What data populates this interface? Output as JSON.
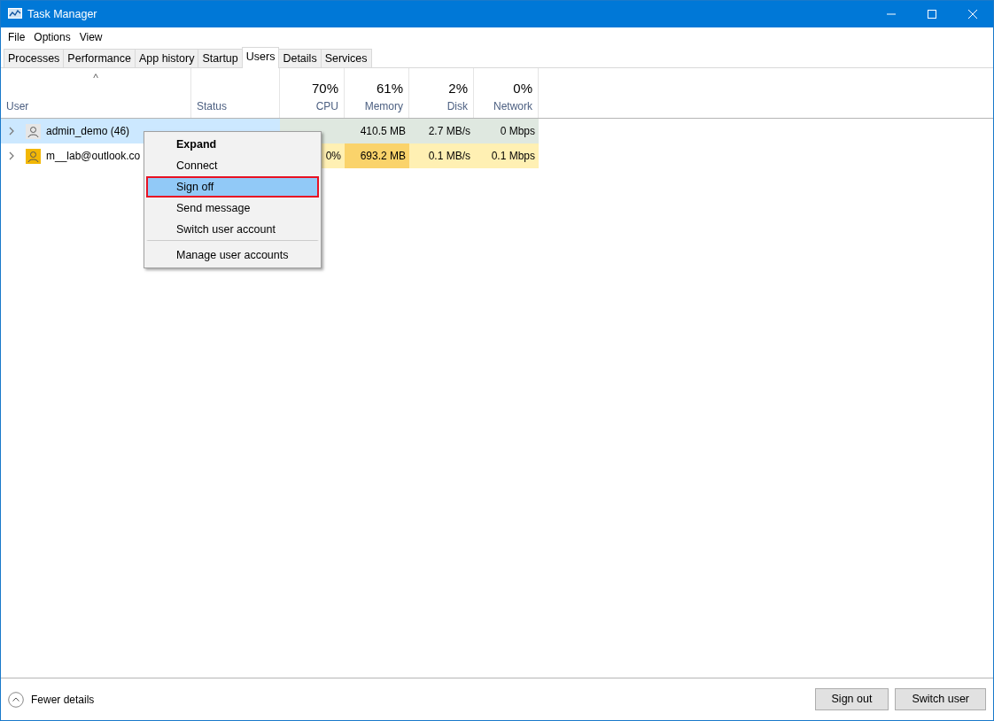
{
  "window": {
    "title": "Task Manager"
  },
  "menu": [
    "File",
    "Options",
    "View"
  ],
  "tabs": [
    {
      "label": "Processes",
      "selected": false
    },
    {
      "label": "Performance",
      "selected": false
    },
    {
      "label": "App history",
      "selected": false
    },
    {
      "label": "Startup",
      "selected": false
    },
    {
      "label": "Users",
      "selected": true
    },
    {
      "label": "Details",
      "selected": false
    },
    {
      "label": "Services",
      "selected": false
    }
  ],
  "table": {
    "sort_indicator": "^",
    "columns": [
      {
        "label": "User"
      },
      {
        "label": "Status"
      },
      {
        "label": "CPU",
        "total": "70%"
      },
      {
        "label": "Memory",
        "total": "61%"
      },
      {
        "label": "Disk",
        "total": "2%"
      },
      {
        "label": "Network",
        "total": "0%"
      }
    ],
    "rows": [
      {
        "selected": true,
        "expanded": false,
        "avatar": {
          "color": "#e6e6e6"
        },
        "cells": [
          {
            "text": "admin_demo (46)"
          },
          {
            "text": ""
          },
          {
            "text": "",
            "color": "#dfe8e0"
          },
          {
            "text": "410.5 MB",
            "color": "#dfe8e0"
          },
          {
            "text": "2.7 MB/s",
            "color": "#dfe8e0"
          },
          {
            "text": "0 Mbps",
            "color": "#dfe8e0"
          }
        ]
      },
      {
        "selected": false,
        "expanded": false,
        "avatar": {
          "color": "#f2b705"
        },
        "cells": [
          {
            "text": "m__lab@outlook.co"
          },
          {
            "text": ""
          },
          {
            "text": "0%",
            "color": "#fff0b3"
          },
          {
            "text": "693.2 MB",
            "color": "#fad36b"
          },
          {
            "text": "0.1 MB/s",
            "color": "#fff0b3"
          },
          {
            "text": "0.1 Mbps",
            "color": "#fff0b3"
          }
        ]
      }
    ]
  },
  "context_menu": {
    "items": [
      {
        "label": "Expand",
        "bold": true,
        "highlighted": false
      },
      {
        "label": "Connect",
        "bold": false,
        "highlighted": false
      },
      {
        "label": "Sign off",
        "bold": false,
        "highlighted": true
      },
      {
        "label": "Send message",
        "bold": false,
        "highlighted": false
      },
      {
        "label": "Switch user account",
        "bold": false,
        "highlighted": false,
        "separator_after": true
      },
      {
        "label": "Manage user accounts",
        "bold": false,
        "highlighted": false
      }
    ]
  },
  "footer": {
    "toggle": "Fewer details",
    "buttons": [
      "Sign out",
      "Switch user"
    ]
  }
}
